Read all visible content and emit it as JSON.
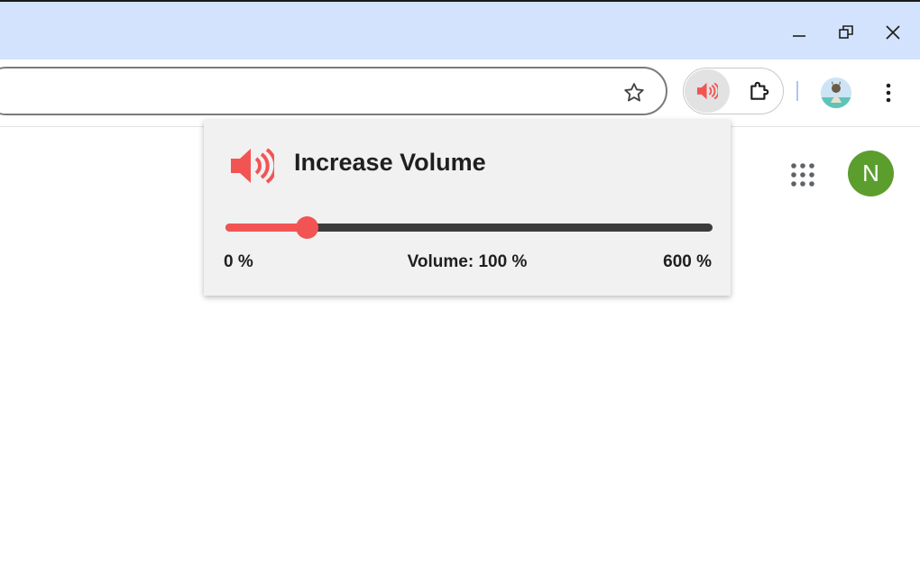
{
  "window": {
    "controls": {
      "minimize": "minimize-icon",
      "restore": "restore-icon",
      "close": "close-icon"
    }
  },
  "toolbar": {
    "omnibox_value": "",
    "bookmark_icon": "star-outline-icon",
    "extensions": [
      {
        "name": "Increase Volume",
        "icon": "speaker-icon",
        "active": true,
        "color": "#f25454"
      },
      {
        "name": "Extensions",
        "icon": "puzzle-icon"
      }
    ],
    "profile_icon": "profile-avatar-icon",
    "menu_icon": "more-vert-icon"
  },
  "page": {
    "apps_icon": "apps-grid-icon",
    "account_initial": "N",
    "account_color": "#5c9e2e"
  },
  "popup": {
    "title": "Increase Volume",
    "icon": "speaker-icon",
    "accent_color": "#f25454",
    "volume": {
      "min_label": "0 %",
      "current_label": "Volume: 100 %",
      "max_label": "600 %",
      "min": 0,
      "max": 600,
      "value": 100
    }
  }
}
